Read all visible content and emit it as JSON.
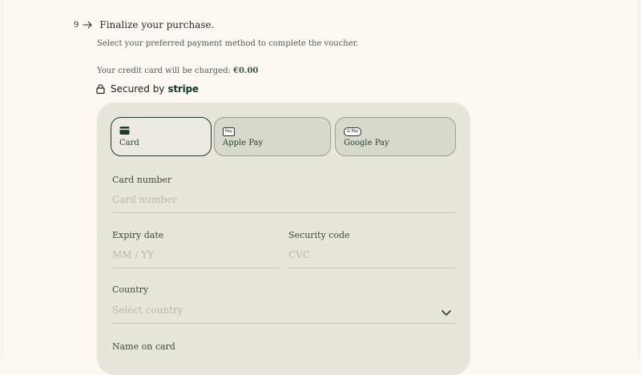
{
  "step": {
    "number": "9",
    "title": "Finalize your purchase."
  },
  "subtitle": "Select your preferred payment method to complete the voucher.",
  "charge": {
    "prefix": "Your credit card will be charged: ",
    "amount": "€0.00"
  },
  "secured": {
    "label": "Secured by",
    "brand": "stripe",
    "icon": "lock-icon"
  },
  "payment_methods": [
    {
      "label": "Card",
      "icon": "credit-card-icon",
      "selected": true
    },
    {
      "label": "Apple Pay",
      "icon": "apple-pay-icon",
      "badge": "Pay",
      "selected": false
    },
    {
      "label": "Google Pay",
      "icon": "google-pay-icon",
      "badge": "G Pay",
      "selected": false
    }
  ],
  "fields": {
    "card_number": {
      "label": "Card number",
      "placeholder": "Card number"
    },
    "expiry": {
      "label": "Expiry date",
      "placeholder": "MM / YY"
    },
    "security_code": {
      "label": "Security code",
      "placeholder": "CVC"
    },
    "country": {
      "label": "Country",
      "placeholder": "Select country"
    },
    "name_on_card": {
      "label": "Name on card"
    }
  },
  "colors": {
    "page_background": "#fdf8f1",
    "panel_background": "#e7e6da",
    "accent_dark_green": "#23382c",
    "placeholder_text": "#b6b8ad"
  }
}
